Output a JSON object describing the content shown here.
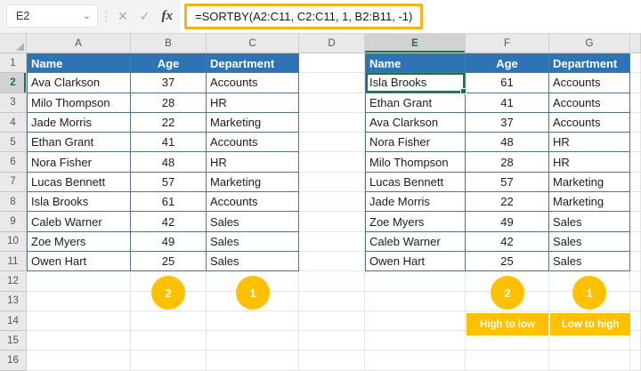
{
  "formula_bar": {
    "name_box_value": "E2",
    "formula": "=SORTBY(A2:C11, C2:C11, 1, B2:B11, -1)",
    "icons": {
      "dropdown": "⌄",
      "grip": "⋮",
      "cancel": "✕",
      "enter": "✓",
      "insert_function": "fx"
    }
  },
  "grid": {
    "column_letters": [
      "A",
      "B",
      "C",
      "D",
      "E",
      "F",
      "G"
    ],
    "row_numbers": [
      1,
      2,
      3,
      4,
      5,
      6,
      7,
      8,
      9,
      10,
      11,
      12,
      13,
      14,
      15,
      16
    ],
    "selected_cell": "E2",
    "selected_column": "E",
    "selected_row": 2
  },
  "table_headers": [
    "Name",
    "Age",
    "Department"
  ],
  "source_table": {
    "range": "A1:C11",
    "rows": [
      {
        "name": "Ava Clarkson",
        "age": 37,
        "department": "Accounts"
      },
      {
        "name": "Milo Thompson",
        "age": 28,
        "department": "HR"
      },
      {
        "name": "Jade Morris",
        "age": 22,
        "department": "Marketing"
      },
      {
        "name": "Ethan Grant",
        "age": 41,
        "department": "Accounts"
      },
      {
        "name": "Nora Fisher",
        "age": 48,
        "department": "HR"
      },
      {
        "name": "Lucas Bennett",
        "age": 57,
        "department": "Marketing"
      },
      {
        "name": "Isla Brooks",
        "age": 61,
        "department": "Accounts"
      },
      {
        "name": "Caleb Warner",
        "age": 42,
        "department": "Sales"
      },
      {
        "name": "Zoe Myers",
        "age": 49,
        "department": "Sales"
      },
      {
        "name": "Owen Hart",
        "age": 25,
        "department": "Sales"
      }
    ]
  },
  "result_table": {
    "range": "E1:G11",
    "rows": [
      {
        "name": "Isla Brooks",
        "age": 61,
        "department": "Accounts"
      },
      {
        "name": "Ethan Grant",
        "age": 41,
        "department": "Accounts"
      },
      {
        "name": "Ava Clarkson",
        "age": 37,
        "department": "Accounts"
      },
      {
        "name": "Nora Fisher",
        "age": 48,
        "department": "HR"
      },
      {
        "name": "Milo Thompson",
        "age": 28,
        "department": "HR"
      },
      {
        "name": "Lucas Bennett",
        "age": 57,
        "department": "Marketing"
      },
      {
        "name": "Jade Morris",
        "age": 22,
        "department": "Marketing"
      },
      {
        "name": "Zoe Myers",
        "age": 49,
        "department": "Sales"
      },
      {
        "name": "Caleb Warner",
        "age": 42,
        "department": "Sales"
      },
      {
        "name": "Owen Hart",
        "age": 25,
        "department": "Sales"
      }
    ]
  },
  "annotations": {
    "badges": [
      {
        "label": "2",
        "column": "B"
      },
      {
        "label": "1",
        "column": "C"
      },
      {
        "label": "2",
        "column": "F"
      },
      {
        "label": "1",
        "column": "G"
      }
    ],
    "sort_labels": [
      {
        "text": "High to low",
        "column": "F"
      },
      {
        "text": "Low to high",
        "column": "G"
      }
    ]
  },
  "colors": {
    "table_header_fill": "#2E74B5",
    "annotation_yellow": "#FFC000",
    "formula_highlight_border": "#F2B31B",
    "selection_green": "#217346"
  }
}
